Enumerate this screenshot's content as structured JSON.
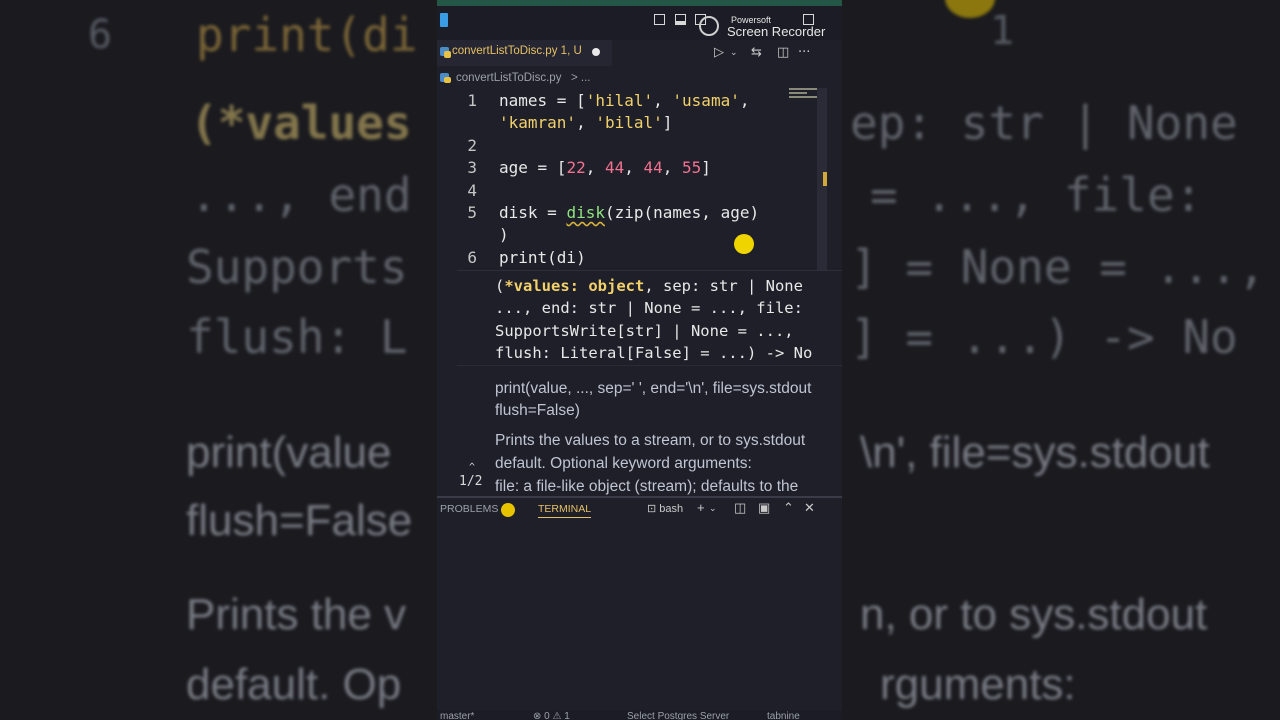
{
  "background": {
    "line_number": "6",
    "code_lines": [
      "print(di",
      "(*values",
      "..., end",
      "Supports",
      "flush: L"
    ],
    "right_lines": [
      "ep: str | None",
      "= ..., file:",
      "] = None = ...,",
      "] = ...) -> No"
    ],
    "doc_lines_left": [
      "print(value",
      "flush=False",
      "Prints the v",
      "default. Op"
    ],
    "doc_lines_right": [
      "\\n', file=sys.stdout",
      "n, or to sys.stdout",
      "rguments:"
    ],
    "right_number": "1"
  },
  "titlebar": {
    "recorder_small": "Powersoft",
    "recorder_big": "Screen Recorder"
  },
  "tab": {
    "label": "convertListToDisc.py",
    "badge": "1, U"
  },
  "breadcrumb": {
    "file": "convertListToDisc.py",
    "tail": "> ..."
  },
  "editor": {
    "line_numbers": [
      "1",
      "",
      "2",
      "3",
      "4",
      "5",
      "",
      "6"
    ],
    "line1": {
      "a": "names = [",
      "s1": "'hilal'",
      "c1": ", ",
      "s2": "'usama'",
      "c2": ","
    },
    "line1b": {
      "s3": "'kamran'",
      "c3": ", ",
      "s4": "'bilal'",
      "c4": "]"
    },
    "line3": {
      "a": "age = [",
      "n1": "22",
      "c1": ", ",
      "n2": "44",
      "c2": ", ",
      "n3": "44",
      "c3": ", ",
      "n4": "55",
      "c4": "]"
    },
    "line5": {
      "a": "disk = ",
      "fn": "disk",
      "b": "(zip(names, age)"
    },
    "line5b": ")",
    "line6": "print(di)"
  },
  "hover": {
    "sig1_pre": "(",
    "sig1_bold": "*values: object",
    "sig1_post": ", sep: str | None",
    "sig2": "..., end: str | None = ..., file:",
    "sig3": "SupportsWrite[str] | None = ...,",
    "sig4": "flush: Literal[False] = ...) -> No",
    "doc1": "print(value, ..., sep=' ', end='\\n', file=sys.stdout",
    "doc2": "flush=False)",
    "doc3": "Prints the values to a stream, or to sys.stdout",
    "doc4": "default. Optional keyword arguments:",
    "doc5": "file: a file-like object (stream); defaults to the",
    "counter": "1/2"
  },
  "panel": {
    "problems": "PROBLEMS",
    "terminal": "TERMINAL",
    "shell": "bash"
  },
  "statusbar": {
    "branch": "master*",
    "errors": "⊗ 0 ⚠ 1",
    "server": "Select Postgres Server",
    "ext": "tabnine"
  },
  "colors": {
    "string": "#f2d16b",
    "number": "#f2728f",
    "function": "#8fe37e",
    "accent": "#e6c065",
    "editor_bg": "#1e1f29"
  }
}
